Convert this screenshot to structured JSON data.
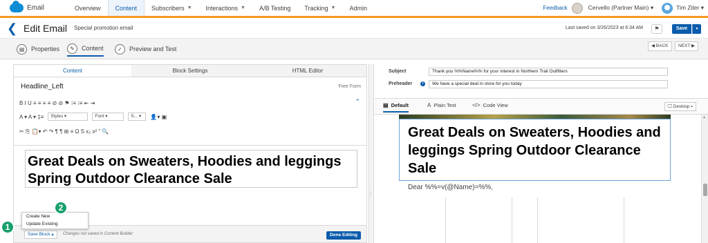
{
  "app": {
    "name": "Email"
  },
  "nav": {
    "tabs": [
      {
        "label": "Overview",
        "caret": ""
      },
      {
        "label": "Content",
        "caret": ""
      },
      {
        "label": "Subscribers",
        "caret": "▼"
      },
      {
        "label": "Interactions",
        "caret": "▼"
      },
      {
        "label": "A/B Testing",
        "caret": ""
      },
      {
        "label": "Tracking",
        "caret": "▼"
      },
      {
        "label": "Admin",
        "caret": ""
      }
    ],
    "feedback": "Feedback",
    "account": "Cervello (Partner Main) ▾",
    "user": "Tim Ziter ▾"
  },
  "header": {
    "title": "Edit Email",
    "subtitle": "Special promotion email",
    "last_saved": "Last saved on 3/26/2023 at 6:34 AM",
    "save_label": "Save",
    "save_caret": "▾",
    "back_glyph": "❮",
    "tag_glyph": "⚑"
  },
  "steps": {
    "items": [
      {
        "label": "Properties",
        "glyph": "▤"
      },
      {
        "label": "Content",
        "glyph": "✎"
      },
      {
        "label": "Preview and Test",
        "glyph": "✓"
      }
    ],
    "back_label": "◀ BACK",
    "next_label": "NEXT ▶"
  },
  "editor": {
    "tabs": [
      "Content",
      "Block Settings",
      "HTML Editor"
    ],
    "block_name": "Headline_Left",
    "mode": "Free Form",
    "toolbar1": "B  I  U  ≡  ≡  ≡  ≡  ⊘  ⊘  ⚑  ⁝≡  ⁝≡  ⇤  ⇥",
    "toolbar2_prefix": "A ▾  A ▾  ‡≡",
    "selects": {
      "styles": "Styles ▾",
      "font": "Font ▾",
      "size": "S... ▾"
    },
    "toolbar2_suffix": "👤▾  ▣",
    "toolbar3": "✂  ⎘  📋▾  ↶  ↷  ¶  ¶  ⊞  ≡  Ω  S  x₂  x²  ”  🔍",
    "collapse_glyph": "⌃",
    "headline": "Great Deals on Sweaters, Hoodies and leggings Spring Outdoor Clearance Sale",
    "save_block": "Save Block ▴",
    "unsaved_note": "Changes not saved in Content Builder",
    "done_label": "Done Editing",
    "menu_items": [
      "Create New",
      "Update Existing"
    ],
    "callouts": [
      "1",
      "2"
    ]
  },
  "envelope": {
    "subject_label": "Subject",
    "subject_value": "Thank you %%Name%% for your interest in Northern Trail Outfitters",
    "preheader_label": "Preheader",
    "preheader_value": "We have a special deal in store for you today",
    "info_glyph": "i"
  },
  "preview": {
    "tabs": [
      {
        "label": "Default",
        "glyph": "▤"
      },
      {
        "label": "Plain Text",
        "glyph": "A"
      },
      {
        "label": "Code View",
        "glyph": "</>"
      }
    ],
    "device": "🖵 Desktop ▾",
    "headline": "Great Deals on Sweaters, Hoodies and leggings Spring Outdoor Clearance Sale",
    "greeting": "Dear %%=v(@Name)=%%,"
  },
  "splitter": {
    "grip": "⁞"
  },
  "colors": {
    "accent": "#0b5cab",
    "nav_underline": "#f59a23",
    "callout": "#18a06b"
  }
}
